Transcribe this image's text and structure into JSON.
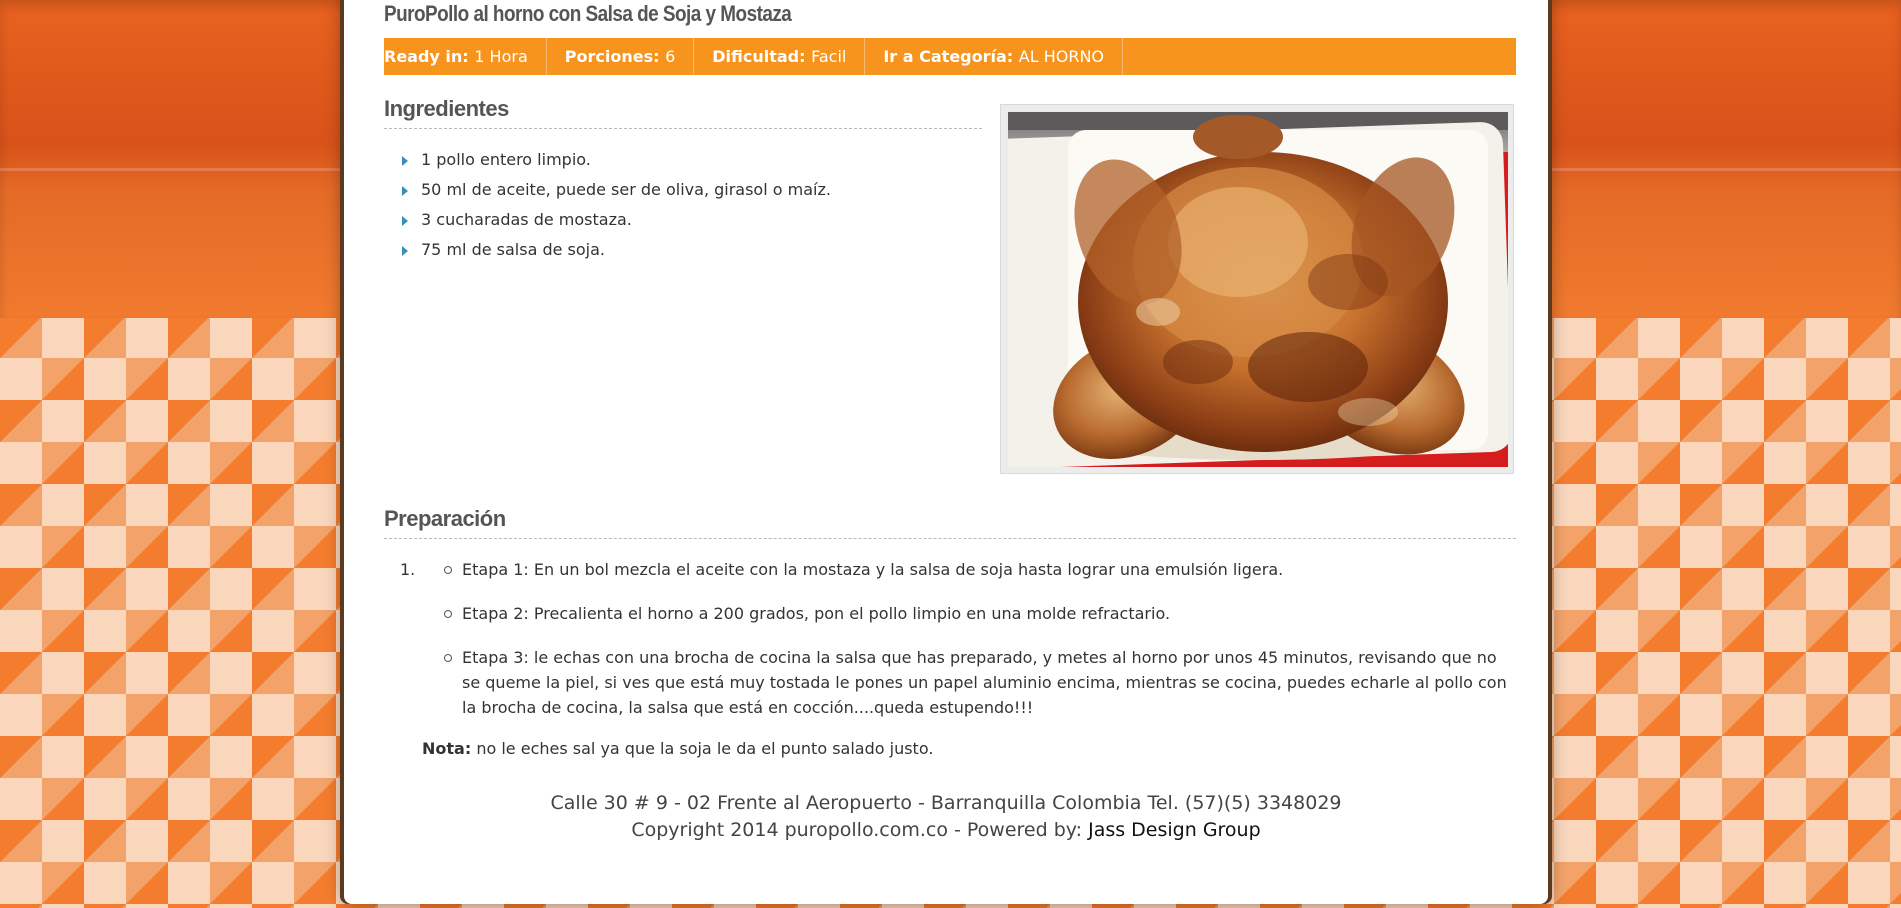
{
  "recipe": {
    "title": "PuroPollo al horno con Salsa de Soja y Mostaza",
    "meta": {
      "ready_label": "Ready in:",
      "ready_value": "1 Hora",
      "portions_label": "Porciones:",
      "portions_value": "6",
      "difficulty_label": "Dificultad:",
      "difficulty_value": "Facil",
      "category_label": "Ir a Categoría:",
      "category_value": "AL HORNO"
    }
  },
  "ingredients": {
    "heading": "Ingredientes",
    "items": [
      "1 pollo entero limpio.",
      "50 ml de aceite, puede ser de oliva, girasol o maíz.",
      "3 cucharadas de mostaza.",
      "75 ml de salsa de soja."
    ]
  },
  "photo": {
    "subject": "roast-chicken-photo"
  },
  "preparation": {
    "heading": "Preparación",
    "number": "1.",
    "steps": [
      "Etapa 1: En un bol mezcla el aceite con la mostaza y la salsa de soja hasta lograr una emulsión ligera.",
      "Etapa 2: Precalienta el horno a 200 grados, pon el pollo limpio en una molde refractario.",
      "Etapa 3: le echas con una brocha de cocina la salsa que has preparado, y metes al horno por unos 45 minutos, revisando que no se queme la piel, si ves que está muy tostada le pones un papel aluminio encima, mientras se cocina, puedes echarle al pollo con la brocha de cocina, la salsa que está en cocción....queda estupendo!!!"
    ],
    "note_label": "Nota:",
    "note_text": "no le eches sal ya que la soja le da el punto salado justo."
  },
  "footer": {
    "address": "Calle 30 # 9 - 02 Frente al Aeropuerto - Barranquilla Colombia Tel. (57)(5) 3348029",
    "copyright": "Copyright 2014 puropollo.com.co - Powered by:",
    "powered_link": "Jass Design Group"
  },
  "colors": {
    "meta_bar": "#f7941e",
    "bullet": "#3a8fb7",
    "background_orange": "#f47c2e"
  }
}
